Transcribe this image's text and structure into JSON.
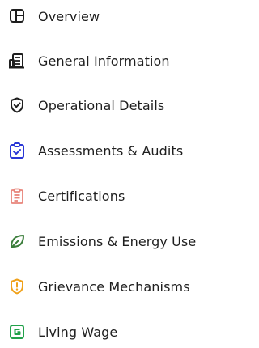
{
  "nav": {
    "items": [
      {
        "label": "Overview",
        "icon": "overview-icon",
        "color": "#1e1e1e"
      },
      {
        "label": "General Information",
        "icon": "building-icon",
        "color": "#1e1e1e"
      },
      {
        "label": "Operational Details",
        "icon": "shield-check-icon",
        "color": "#1e1e1e"
      },
      {
        "label": "Assessments & Audits",
        "icon": "clipboard-check-icon",
        "color": "#2a37d6"
      },
      {
        "label": "Certifications",
        "icon": "document-icon",
        "color": "#e8847a"
      },
      {
        "label": "Emissions & Energy Use",
        "icon": "leaf-icon",
        "color": "#3b7d3b"
      },
      {
        "label": "Grievance Mechanisms",
        "icon": "shield-alert-icon",
        "color": "#f0a11a"
      },
      {
        "label": "Living Wage",
        "icon": "wage-icon",
        "color": "#22a14a"
      }
    ]
  }
}
